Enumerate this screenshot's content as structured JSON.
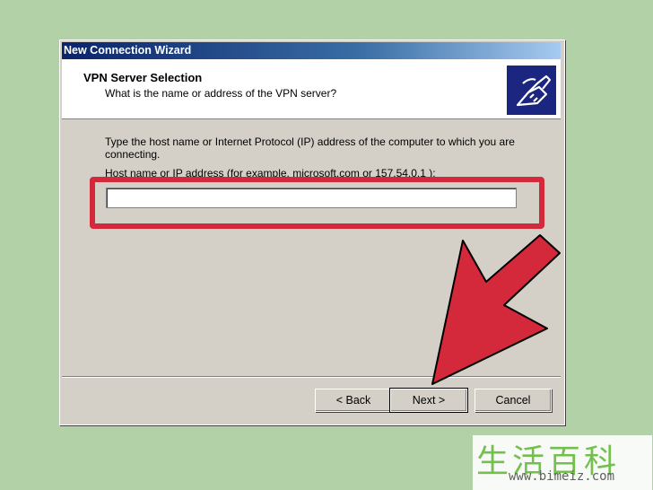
{
  "window": {
    "title": "New Connection Wizard"
  },
  "header": {
    "title": "VPN Server Selection",
    "subtitle": "What is the name or address of the VPN server?"
  },
  "main": {
    "description": "Type the host name or Internet Protocol (IP) address of the computer to which you are connecting.",
    "field_label": "Host name or IP address (for example, microsoft.com or 157.54.0.1 ):",
    "host_value": ""
  },
  "buttons": {
    "back": "< Back",
    "next": "Next >",
    "cancel": "Cancel"
  },
  "annotation": {
    "highlight_color": "#d3293a",
    "arrow_color": "#d3293a"
  },
  "watermark": {
    "chars": "生活百科",
    "url": "www.bimeiz.com"
  },
  "icons": {
    "wizard": "network-cable-icon"
  }
}
